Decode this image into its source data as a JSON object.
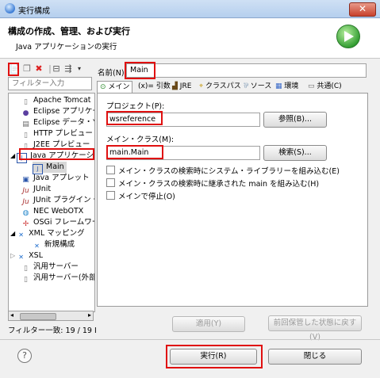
{
  "window": {
    "title": "実行構成",
    "close_label": "✕"
  },
  "header": {
    "heading": "構成の作成、管理、および実行",
    "subtitle": "Java アプリケーションの実行"
  },
  "filter": {
    "placeholder": "フィルター入力",
    "status": "フィルター一致: 19 / 19 I"
  },
  "tree": [
    {
      "label": "Apache Tomcat",
      "icon": "server-icon"
    },
    {
      "label": "Eclipse アプリケー",
      "icon": "eclipse-icon"
    },
    {
      "label": "Eclipse データ・ツ",
      "icon": "database-icon"
    },
    {
      "label": "HTTP プレビュー",
      "icon": "doc-icon"
    },
    {
      "label": "J2EE プレビュー",
      "icon": "doc-icon"
    },
    {
      "label": "Java アプリケーシ",
      "icon": "java-app-icon"
    },
    {
      "label": "Main",
      "icon": "java-app-icon"
    },
    {
      "label": "Java アプレット",
      "icon": "applet-icon"
    },
    {
      "label": "JUnit",
      "icon": "junit-icon"
    },
    {
      "label": "JUnit プラグイン・",
      "icon": "junit-plugin-icon"
    },
    {
      "label": "NEC WebOTX",
      "icon": "globe-icon"
    },
    {
      "label": "OSGi フレームワー",
      "icon": "osgi-icon"
    },
    {
      "label": "XML マッピング",
      "icon": "xml-icon"
    },
    {
      "label": "新規構成",
      "icon": "xml-icon"
    },
    {
      "label": "XSL",
      "icon": "xsl-icon"
    },
    {
      "label": "汎用サーバー",
      "icon": "doc-icon"
    },
    {
      "label": "汎用サーバー(外部",
      "icon": "doc-icon"
    }
  ],
  "config": {
    "name_label": "名前(N):",
    "name_value": "Main",
    "tabs": [
      "メイン",
      "(x)= 引数",
      "JRE",
      "クラスパス",
      "ソース",
      "環境",
      "共通(C)"
    ],
    "project_label": "プロジェクト(P):",
    "project_value": "wsreference",
    "browse_button": "参照(B)...",
    "main_class_label": "メイン・クラス(M):",
    "main_class_value": "main.Main",
    "search_button": "検索(S)...",
    "checkboxes": [
      "メイン・クラスの検索時にシステム・ライブラリーを組み込む(E)",
      "メイン・クラスの検索時に継承された main を組み込む(H)",
      "メインで停止(O)"
    ],
    "apply_button": "適用(Y)",
    "revert_button": "前回保管した状態に戻す(V)"
  },
  "footer": {
    "help": "?",
    "run_button": "実行(R)",
    "close_button": "閉じる"
  }
}
